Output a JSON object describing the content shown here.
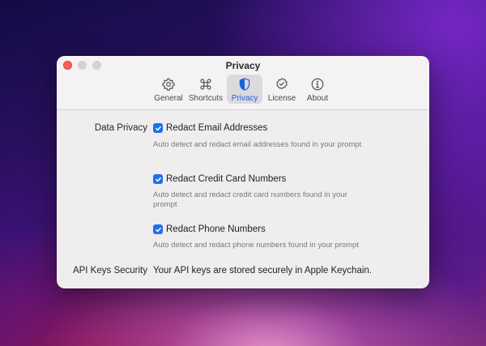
{
  "window": {
    "title": "Privacy"
  },
  "toolbar": {
    "tabs": [
      {
        "id": "general",
        "label": "General",
        "icon": "gear-icon"
      },
      {
        "id": "shortcuts",
        "label": "Shortcuts",
        "icon": "command-key-icon"
      },
      {
        "id": "privacy",
        "label": "Privacy",
        "icon": "shield-icon",
        "active": true
      },
      {
        "id": "license",
        "label": "License",
        "icon": "seal-check-icon"
      },
      {
        "id": "about",
        "label": "About",
        "icon": "info-circle-icon"
      }
    ]
  },
  "privacy": {
    "data_privacy_label": "Data Privacy",
    "options": [
      {
        "label": "Redact Email Addresses",
        "checked": true,
        "description": "Auto detect and redact email addresses found in your prompt"
      },
      {
        "label": "Redact Credit Card Numbers",
        "checked": true,
        "description": "Auto detect and redact credit card numbers found in your prompt"
      },
      {
        "label": "Redact Phone Numbers",
        "checked": true,
        "description": "Auto detect and redact phone numbers found in your prompt"
      }
    ],
    "api_keys_label": "API Keys Security",
    "api_keys_text": "Your API keys are stored securely in Apple Keychain."
  },
  "colors": {
    "accent": "#1b72ec",
    "close_button": "#fe5f57",
    "window_bg": "#efeded"
  }
}
